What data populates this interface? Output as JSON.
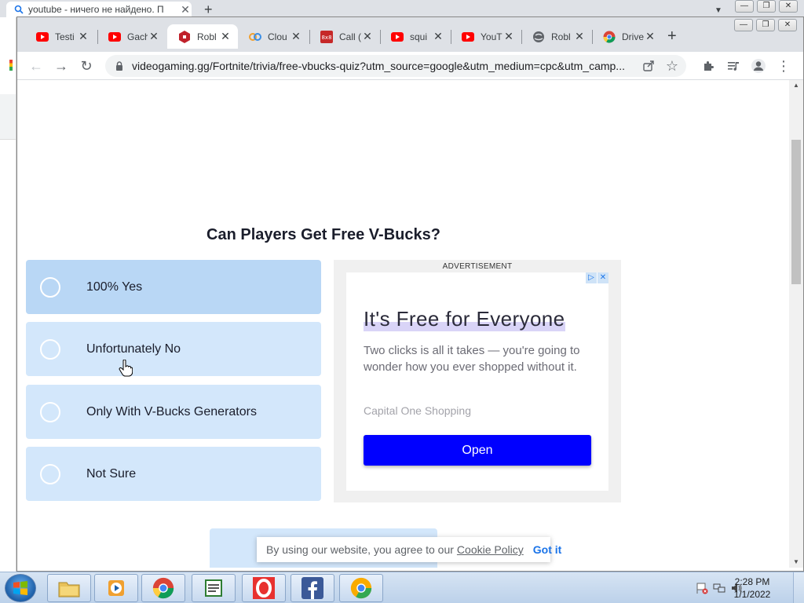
{
  "background_window": {
    "tab_title": "youtube - ничего не найдено. П",
    "close_glyph": "✕",
    "new_tab_glyph": "+",
    "dropdown_glyph": "▼"
  },
  "window_controls": {
    "minimize": "—",
    "restore": "❐",
    "close": "✕"
  },
  "tabs": [
    {
      "label": "Testi",
      "icon": "youtube-icon",
      "close": "✕"
    },
    {
      "label": "Gach",
      "icon": "youtube-icon",
      "close": "✕"
    },
    {
      "label": "Robl",
      "icon": "roblox-icon",
      "close": "✕",
      "active": true
    },
    {
      "label": "Clou",
      "icon": "cloud-icon",
      "close": "✕"
    },
    {
      "label": "Call (",
      "icon": "site-icon",
      "close": "✕"
    },
    {
      "label": "squi",
      "icon": "youtube-icon",
      "close": "✕"
    },
    {
      "label": "YouT",
      "icon": "youtube-icon",
      "close": "✕"
    },
    {
      "label": "Robl",
      "icon": "globe-icon",
      "close": "✕"
    },
    {
      "label": "Drive",
      "icon": "chrome-icon",
      "close": "✕"
    }
  ],
  "new_tab": "+",
  "toolbar": {
    "back": "←",
    "forward": "→",
    "reload": "↻",
    "url": "videogaming.gg/Fortnite/trivia/free-vbucks-quiz?utm_source=google&utm_medium=cpc&utm_camp...",
    "star": "☆",
    "menu": "⋮"
  },
  "quiz": {
    "question": "Can Players Get Free V-Bucks?",
    "answers": [
      "100% Yes",
      "Unfortunately No",
      "Only With V-Bucks Generators",
      "Not Sure"
    ]
  },
  "ad": {
    "label": "ADVERTISEMENT",
    "adchoices": "▷",
    "close": "✕",
    "headline": "It's Free for Everyone",
    "body": "Two clicks is all it takes — you're going to wonder how you ever shopped without it.",
    "brand": "Capital One Shopping",
    "button": "Open"
  },
  "cookie_banner": {
    "text": "By using our website, you agree to our",
    "link": "Cookie Policy",
    "accept": "Got it"
  },
  "scrollbar": {
    "up": "▲",
    "down": "▼"
  },
  "taskbar": {
    "apps": [
      "file-explorer-icon",
      "media-player-icon",
      "chrome-icon",
      "notepad-icon",
      "opera-icon",
      "facebook-icon",
      "chrome-canary-icon"
    ],
    "time": "2:28 PM",
    "date": "1/1/2022"
  },
  "colors": {
    "answer_bg": "#d3e7fb",
    "answer_hover_bg": "#b9d7f5",
    "ad_button": "#0000ff",
    "link_blue": "#1a73e8"
  }
}
